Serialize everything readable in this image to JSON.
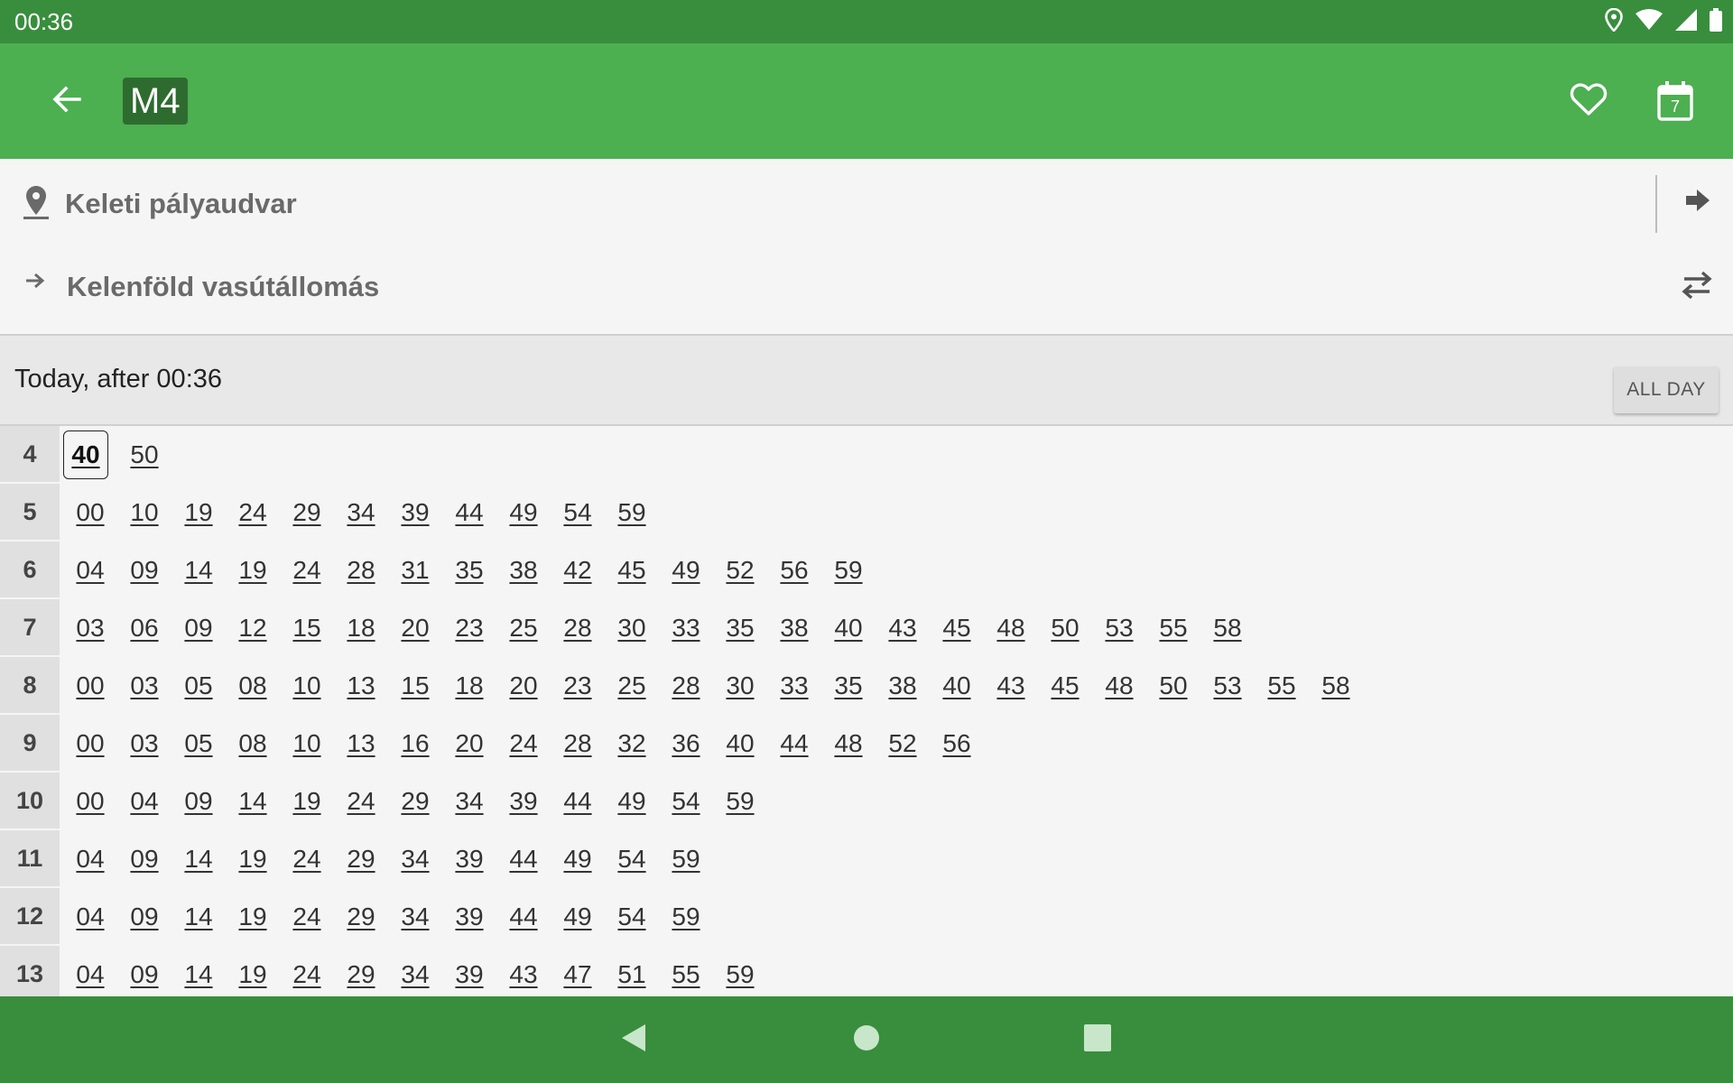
{
  "status_bar": {
    "time": "00:36",
    "icons": [
      "location-icon",
      "wifi-icon",
      "signal-icon",
      "battery-icon"
    ]
  },
  "app_bar": {
    "route": "M4",
    "route_badge_color": "#2e6b2f",
    "bar_color": "#4caf50",
    "calendar_day": "7",
    "icons": [
      "arrow-back-icon",
      "heart-outline-icon",
      "calendar-icon"
    ]
  },
  "stops": {
    "from": "Keleti pályaudvar",
    "to": "Kelenföld vasútállomás"
  },
  "schedule_header": {
    "label": "Today, after 00:36",
    "all_day_button": "ALL DAY"
  },
  "timetable": [
    {
      "hour": "4",
      "minutes": [
        "40",
        "50"
      ]
    },
    {
      "hour": "5",
      "minutes": [
        "00",
        "10",
        "19",
        "24",
        "29",
        "34",
        "39",
        "44",
        "49",
        "54",
        "59"
      ]
    },
    {
      "hour": "6",
      "minutes": [
        "04",
        "09",
        "14",
        "19",
        "24",
        "28",
        "31",
        "35",
        "38",
        "42",
        "45",
        "49",
        "52",
        "56",
        "59"
      ]
    },
    {
      "hour": "7",
      "minutes": [
        "03",
        "06",
        "09",
        "12",
        "15",
        "18",
        "20",
        "23",
        "25",
        "28",
        "30",
        "33",
        "35",
        "38",
        "40",
        "43",
        "45",
        "48",
        "50",
        "53",
        "55",
        "58"
      ]
    },
    {
      "hour": "8",
      "minutes": [
        "00",
        "03",
        "05",
        "08",
        "10",
        "13",
        "15",
        "18",
        "20",
        "23",
        "25",
        "28",
        "30",
        "33",
        "35",
        "38",
        "40",
        "43",
        "45",
        "48",
        "50",
        "53",
        "55",
        "58"
      ]
    },
    {
      "hour": "9",
      "minutes": [
        "00",
        "03",
        "05",
        "08",
        "10",
        "13",
        "16",
        "20",
        "24",
        "28",
        "32",
        "36",
        "40",
        "44",
        "48",
        "52",
        "56"
      ]
    },
    {
      "hour": "10",
      "minutes": [
        "00",
        "04",
        "09",
        "14",
        "19",
        "24",
        "29",
        "34",
        "39",
        "44",
        "49",
        "54",
        "59"
      ]
    },
    {
      "hour": "11",
      "minutes": [
        "04",
        "09",
        "14",
        "19",
        "24",
        "29",
        "34",
        "39",
        "44",
        "49",
        "54",
        "59"
      ]
    },
    {
      "hour": "12",
      "minutes": [
        "04",
        "09",
        "14",
        "19",
        "24",
        "29",
        "34",
        "39",
        "44",
        "49",
        "54",
        "59"
      ]
    },
    {
      "hour": "13",
      "minutes": [
        "04",
        "09",
        "14",
        "19",
        "24",
        "29",
        "34",
        "39",
        "43",
        "47",
        "51",
        "55",
        "59"
      ]
    }
  ],
  "highlighted_departure": {
    "hour": "4",
    "minute": "40"
  },
  "nav_bar": {
    "icons": [
      "nav-back-icon",
      "nav-home-icon",
      "nav-recents-icon"
    ]
  }
}
